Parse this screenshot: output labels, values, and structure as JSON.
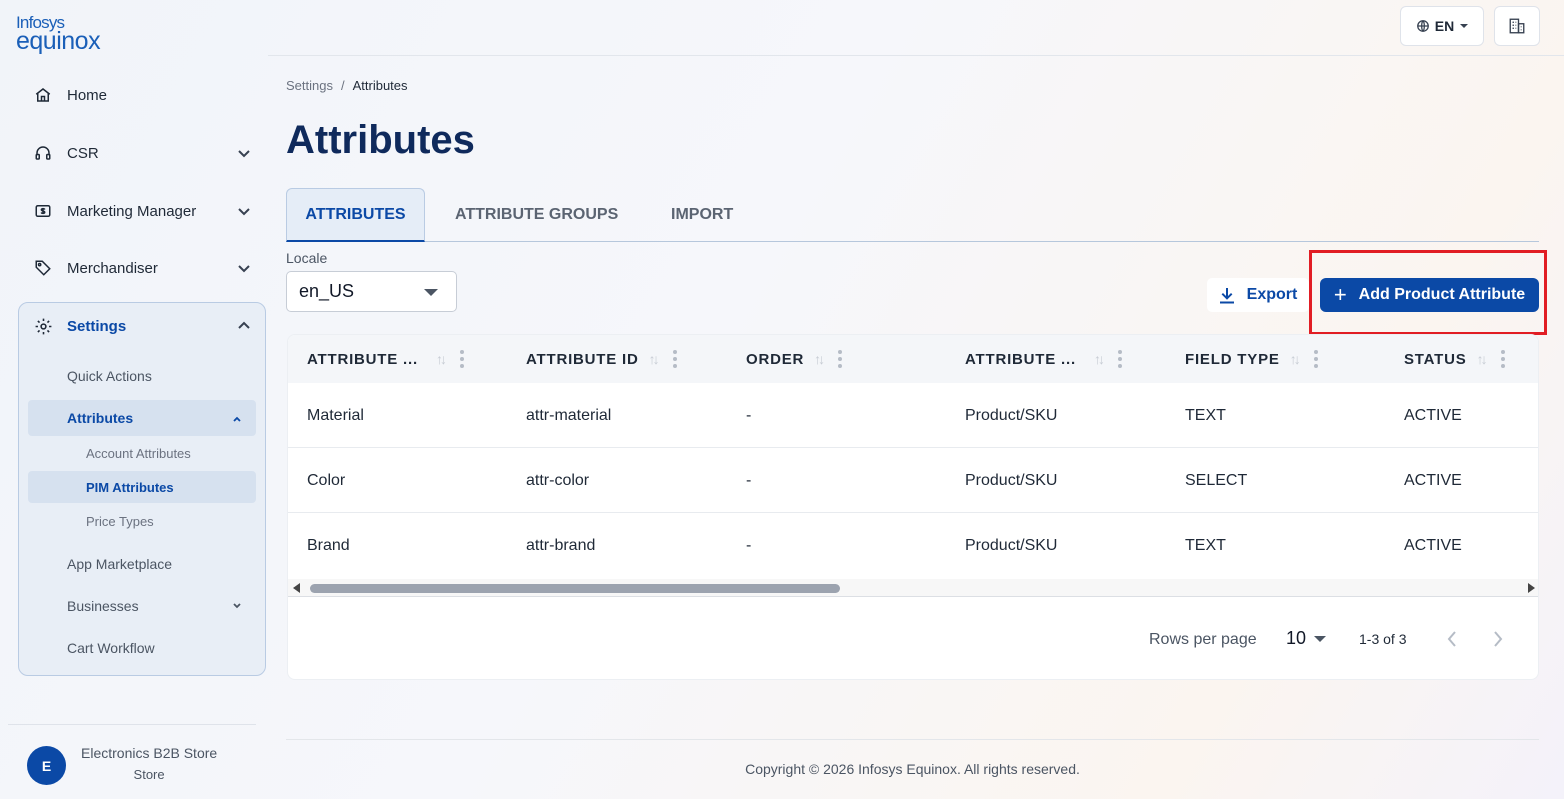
{
  "brand": {
    "line1": "Infosys",
    "line2": "equinox"
  },
  "sidebar": {
    "items": [
      {
        "label": "Home",
        "icon": "home-icon"
      },
      {
        "label": "CSR",
        "icon": "headset-icon"
      },
      {
        "label": "Marketing Manager",
        "icon": "dollar-bill-icon"
      },
      {
        "label": "Merchandiser",
        "icon": "tag-icon"
      },
      {
        "label": "Settings",
        "icon": "gear-icon"
      }
    ],
    "settings_sub": [
      "Quick Actions",
      "Attributes",
      "App Marketplace",
      "Businesses",
      "Cart Workflow"
    ],
    "attributes_sub": [
      "Account Attributes",
      "PIM Attributes",
      "Price Types"
    ],
    "store": {
      "initial": "E",
      "name": "Electronics B2B Store",
      "type": "Store"
    }
  },
  "topbar": {
    "language": "EN"
  },
  "breadcrumb": {
    "root": "Settings",
    "separator": "/",
    "current": "Attributes"
  },
  "page": {
    "title": "Attributes"
  },
  "tabs": [
    "ATTRIBUTES",
    "ATTRIBUTE GROUPS",
    "IMPORT"
  ],
  "locale": {
    "label": "Locale",
    "value": "en_US"
  },
  "actions": {
    "export": "Export",
    "add": "Add Product Attribute"
  },
  "table": {
    "columns": [
      "ATTRIBUTE ...",
      "ATTRIBUTE ID",
      "ORDER",
      "ATTRIBUTE ...",
      "FIELD TYPE",
      "STATUS"
    ],
    "rows": [
      [
        "Material",
        "attr-material",
        "-",
        "Product/SKU",
        "TEXT",
        "ACTIVE"
      ],
      [
        "Color",
        "attr-color",
        "-",
        "Product/SKU",
        "SELECT",
        "ACTIVE"
      ],
      [
        "Brand",
        "attr-brand",
        "-",
        "Product/SKU",
        "TEXT",
        "ACTIVE"
      ]
    ]
  },
  "pagination": {
    "rows_label": "Rows per page",
    "rows_value": "10",
    "range": "1-3 of 3"
  },
  "footer": {
    "copyright": "Copyright © 2026 Infosys Equinox. All rights reserved."
  },
  "colors": {
    "primary": "#0b49a6",
    "title": "#0f2a5c",
    "highlight": "#e11d24"
  }
}
